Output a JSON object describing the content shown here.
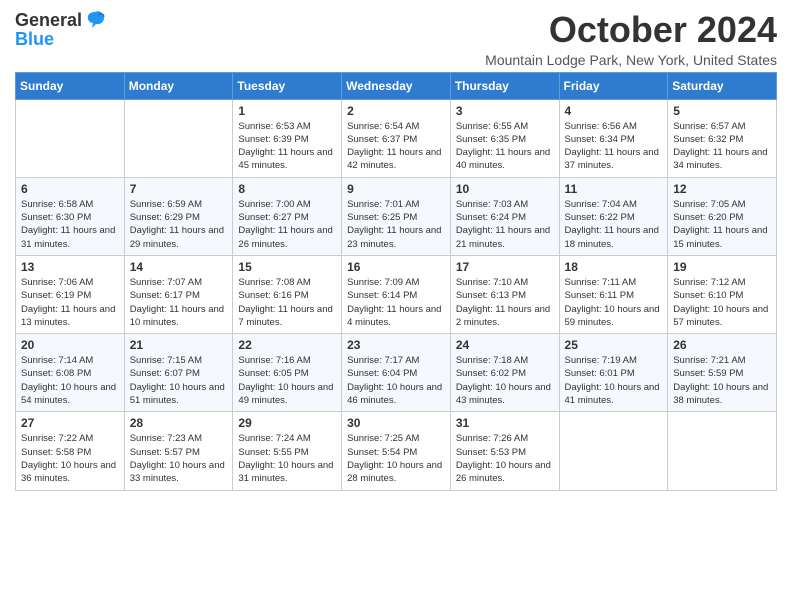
{
  "header": {
    "logo_general": "General",
    "logo_blue": "Blue",
    "month_title": "October 2024",
    "location": "Mountain Lodge Park, New York, United States"
  },
  "days_of_week": [
    "Sunday",
    "Monday",
    "Tuesday",
    "Wednesday",
    "Thursday",
    "Friday",
    "Saturday"
  ],
  "weeks": [
    [
      {
        "day": null,
        "info": ""
      },
      {
        "day": null,
        "info": ""
      },
      {
        "day": "1",
        "sunrise": "6:53 AM",
        "sunset": "6:39 PM",
        "daylight": "11 hours and 45 minutes."
      },
      {
        "day": "2",
        "sunrise": "6:54 AM",
        "sunset": "6:37 PM",
        "daylight": "11 hours and 42 minutes."
      },
      {
        "day": "3",
        "sunrise": "6:55 AM",
        "sunset": "6:35 PM",
        "daylight": "11 hours and 40 minutes."
      },
      {
        "day": "4",
        "sunrise": "6:56 AM",
        "sunset": "6:34 PM",
        "daylight": "11 hours and 37 minutes."
      },
      {
        "day": "5",
        "sunrise": "6:57 AM",
        "sunset": "6:32 PM",
        "daylight": "11 hours and 34 minutes."
      }
    ],
    [
      {
        "day": "6",
        "sunrise": "6:58 AM",
        "sunset": "6:30 PM",
        "daylight": "11 hours and 31 minutes."
      },
      {
        "day": "7",
        "sunrise": "6:59 AM",
        "sunset": "6:29 PM",
        "daylight": "11 hours and 29 minutes."
      },
      {
        "day": "8",
        "sunrise": "7:00 AM",
        "sunset": "6:27 PM",
        "daylight": "11 hours and 26 minutes."
      },
      {
        "day": "9",
        "sunrise": "7:01 AM",
        "sunset": "6:25 PM",
        "daylight": "11 hours and 23 minutes."
      },
      {
        "day": "10",
        "sunrise": "7:03 AM",
        "sunset": "6:24 PM",
        "daylight": "11 hours and 21 minutes."
      },
      {
        "day": "11",
        "sunrise": "7:04 AM",
        "sunset": "6:22 PM",
        "daylight": "11 hours and 18 minutes."
      },
      {
        "day": "12",
        "sunrise": "7:05 AM",
        "sunset": "6:20 PM",
        "daylight": "11 hours and 15 minutes."
      }
    ],
    [
      {
        "day": "13",
        "sunrise": "7:06 AM",
        "sunset": "6:19 PM",
        "daylight": "11 hours and 13 minutes."
      },
      {
        "day": "14",
        "sunrise": "7:07 AM",
        "sunset": "6:17 PM",
        "daylight": "11 hours and 10 minutes."
      },
      {
        "day": "15",
        "sunrise": "7:08 AM",
        "sunset": "6:16 PM",
        "daylight": "11 hours and 7 minutes."
      },
      {
        "day": "16",
        "sunrise": "7:09 AM",
        "sunset": "6:14 PM",
        "daylight": "11 hours and 4 minutes."
      },
      {
        "day": "17",
        "sunrise": "7:10 AM",
        "sunset": "6:13 PM",
        "daylight": "11 hours and 2 minutes."
      },
      {
        "day": "18",
        "sunrise": "7:11 AM",
        "sunset": "6:11 PM",
        "daylight": "10 hours and 59 minutes."
      },
      {
        "day": "19",
        "sunrise": "7:12 AM",
        "sunset": "6:10 PM",
        "daylight": "10 hours and 57 minutes."
      }
    ],
    [
      {
        "day": "20",
        "sunrise": "7:14 AM",
        "sunset": "6:08 PM",
        "daylight": "10 hours and 54 minutes."
      },
      {
        "day": "21",
        "sunrise": "7:15 AM",
        "sunset": "6:07 PM",
        "daylight": "10 hours and 51 minutes."
      },
      {
        "day": "22",
        "sunrise": "7:16 AM",
        "sunset": "6:05 PM",
        "daylight": "10 hours and 49 minutes."
      },
      {
        "day": "23",
        "sunrise": "7:17 AM",
        "sunset": "6:04 PM",
        "daylight": "10 hours and 46 minutes."
      },
      {
        "day": "24",
        "sunrise": "7:18 AM",
        "sunset": "6:02 PM",
        "daylight": "10 hours and 43 minutes."
      },
      {
        "day": "25",
        "sunrise": "7:19 AM",
        "sunset": "6:01 PM",
        "daylight": "10 hours and 41 minutes."
      },
      {
        "day": "26",
        "sunrise": "7:21 AM",
        "sunset": "5:59 PM",
        "daylight": "10 hours and 38 minutes."
      }
    ],
    [
      {
        "day": "27",
        "sunrise": "7:22 AM",
        "sunset": "5:58 PM",
        "daylight": "10 hours and 36 minutes."
      },
      {
        "day": "28",
        "sunrise": "7:23 AM",
        "sunset": "5:57 PM",
        "daylight": "10 hours and 33 minutes."
      },
      {
        "day": "29",
        "sunrise": "7:24 AM",
        "sunset": "5:55 PM",
        "daylight": "10 hours and 31 minutes."
      },
      {
        "day": "30",
        "sunrise": "7:25 AM",
        "sunset": "5:54 PM",
        "daylight": "10 hours and 28 minutes."
      },
      {
        "day": "31",
        "sunrise": "7:26 AM",
        "sunset": "5:53 PM",
        "daylight": "10 hours and 26 minutes."
      },
      {
        "day": null,
        "info": ""
      },
      {
        "day": null,
        "info": ""
      }
    ]
  ]
}
